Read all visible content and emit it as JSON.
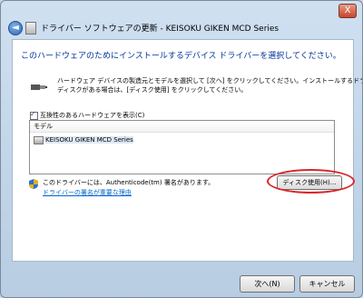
{
  "window": {
    "title": "ドライバー ソフトウェアの更新 - KEISOKU GIKEN MCD Series",
    "close_glyph": "X",
    "back_glyph": "◄"
  },
  "main": {
    "heading": "このハードウェアのためにインストールするデバイス ドライバーを選択してください。",
    "description": [
      "ハードウェア デバイスの製造元とモデルを選択して [次へ] をクリックしてください。インストールするドライバーの",
      "ディスクがある場合は、[ディスク使用] をクリックしてください。"
    ],
    "compatible_checkbox": {
      "label": "互換性のあるハードウェアを表示(C)",
      "checked": true
    },
    "model_list": {
      "column": "モデル",
      "items": [
        "KEISOKU GIKEN MCD Series"
      ]
    },
    "signature_text": "このドライバーには、Authenticode(tm) 署名があります。",
    "signature_link": "ドライバーの署名が重要な理由",
    "have_disk_button": "ディスク使用(H)..."
  },
  "footer": {
    "next_button": "次へ(N)",
    "cancel_button": "キャンセル"
  },
  "colors": {
    "heading": "#003399",
    "link": "#0066cc",
    "highlight": "#d9262a"
  }
}
